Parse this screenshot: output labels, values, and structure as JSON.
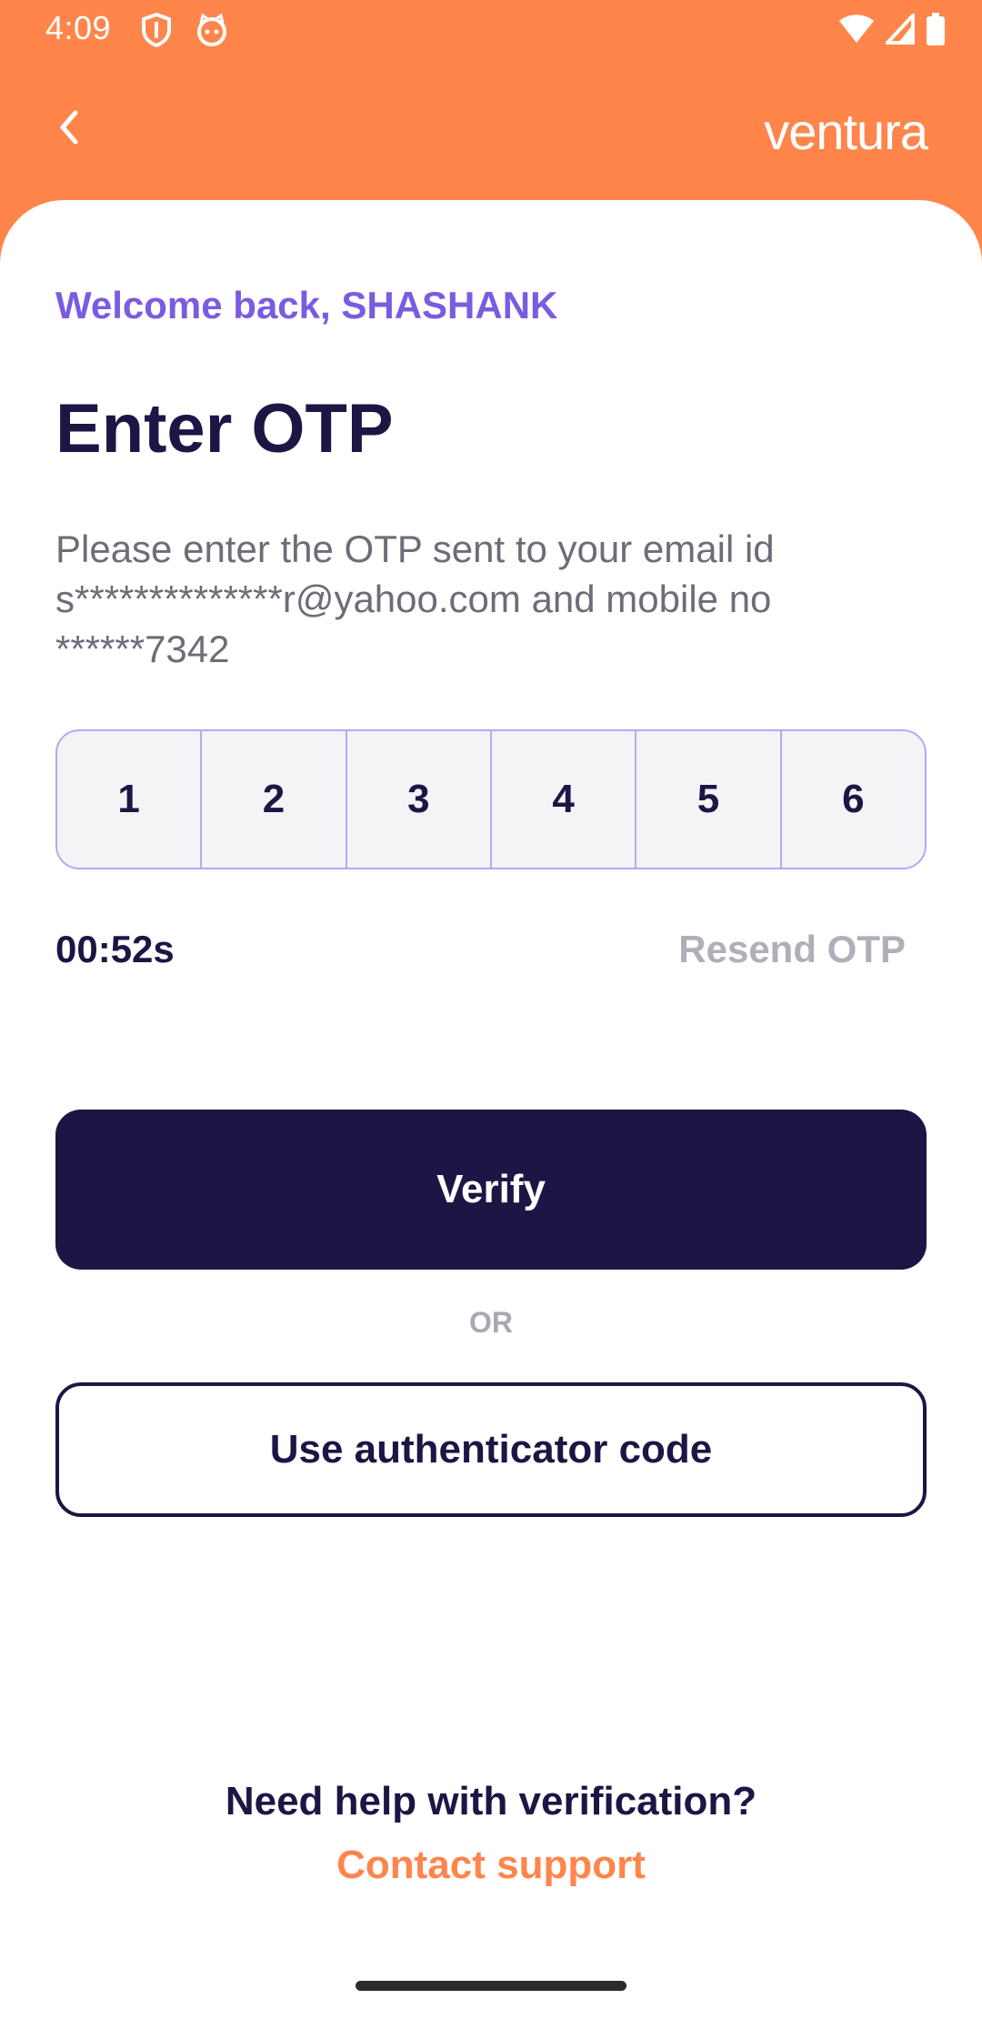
{
  "status_bar": {
    "time": "4:09",
    "icons": [
      "shield-icon",
      "cat-face-icon",
      "wifi-icon",
      "signal-icon",
      "battery-icon"
    ]
  },
  "app_bar": {
    "back_icon": "chevron-left-icon",
    "brand": "ventura"
  },
  "content": {
    "welcome": "Welcome back, SHASHANK",
    "title": "Enter OTP",
    "description": "Please enter the OTP sent to your email id s**************r@yahoo.com and mobile no ******7342",
    "otp_digits": [
      "1",
      "2",
      "3",
      "4",
      "5",
      "6"
    ],
    "timer": "00:52s",
    "resend_label": "Resend OTP",
    "verify_label": "Verify",
    "or_label": "OR",
    "auth_label": "Use authenticator code",
    "help_text": "Need help with verification?",
    "contact_label": "Contact support"
  },
  "colors": {
    "brand_orange": "#ff854b",
    "primary_dark": "#1c1645",
    "accent_purple": "#7a5ce0",
    "muted_gray": "#b0afb9"
  }
}
